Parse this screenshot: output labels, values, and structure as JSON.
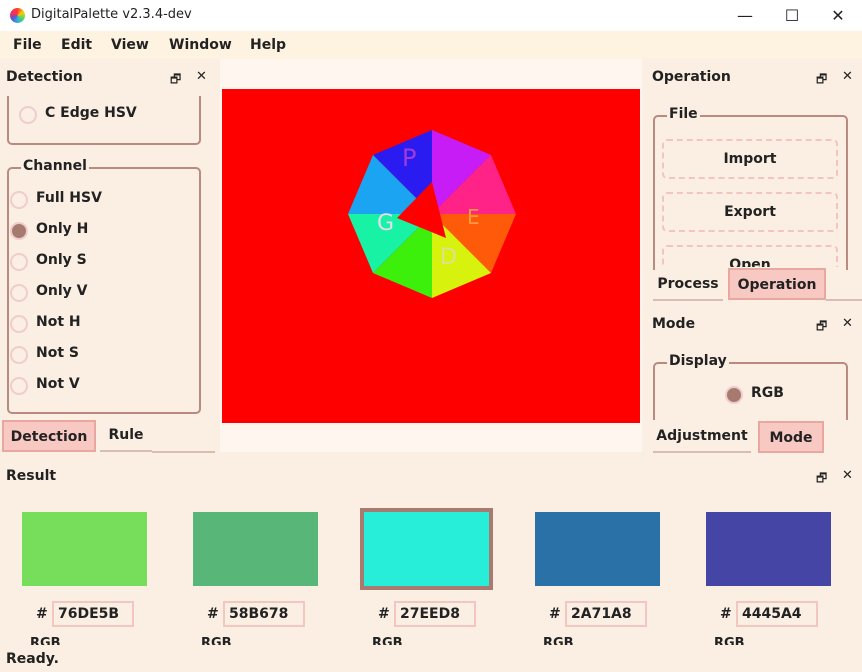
{
  "window": {
    "title": "DigitalPalette v2.3.4-dev",
    "minimize": "—",
    "maximize": "☐",
    "close": "✕"
  },
  "menu": [
    "File",
    "Edit",
    "View",
    "Window",
    "Help"
  ],
  "dock_buttons": {
    "float": "🗗",
    "close": "✕"
  },
  "detection_panel": {
    "title": "Detection",
    "cut_option": "C Edge HSV",
    "channel_group": {
      "title": "Channel",
      "options": [
        {
          "label": "Full HSV",
          "checked": false
        },
        {
          "label": "Only H",
          "checked": true
        },
        {
          "label": "Only S",
          "checked": false
        },
        {
          "label": "Only V",
          "checked": false
        },
        {
          "label": "Not H",
          "checked": false
        },
        {
          "label": "Not S",
          "checked": false
        },
        {
          "label": "Not V",
          "checked": false
        }
      ]
    },
    "tabs": [
      {
        "label": "Detection",
        "active": true
      },
      {
        "label": "Rule",
        "active": false
      }
    ]
  },
  "operation_panel": {
    "title": "Operation",
    "file_group": {
      "title": "File",
      "buttons": [
        "Import",
        "Export",
        "Open"
      ]
    },
    "tabs": [
      {
        "label": "Process",
        "active": false
      },
      {
        "label": "Operation",
        "active": true
      }
    ]
  },
  "mode_panel": {
    "title": "Mode",
    "display_group": {
      "title": "Display",
      "option": "RGB",
      "checked": true
    },
    "tabs": [
      {
        "label": "Adjustment",
        "active": false
      },
      {
        "label": "Mode",
        "active": true
      }
    ]
  },
  "canvas": {
    "background": "#ff0000",
    "image": "hue-wheel-octagon"
  },
  "result_panel": {
    "title": "Result",
    "hash_symbol": "#",
    "colors": [
      {
        "hex": "76DE5B",
        "color": "#76DE5B",
        "selected": false,
        "mode_label": "RGB"
      },
      {
        "hex": "58B678",
        "color": "#58B678",
        "selected": false,
        "mode_label": "RGB"
      },
      {
        "hex": "27EED8",
        "color": "#27EED8",
        "selected": true,
        "mode_label": "RGB"
      },
      {
        "hex": "2A71A8",
        "color": "#2A71A8",
        "selected": false,
        "mode_label": "RGB"
      },
      {
        "hex": "4445A4",
        "color": "#4445A4",
        "selected": false,
        "mode_label": "RGB"
      }
    ]
  },
  "status": {
    "text": "Ready."
  }
}
